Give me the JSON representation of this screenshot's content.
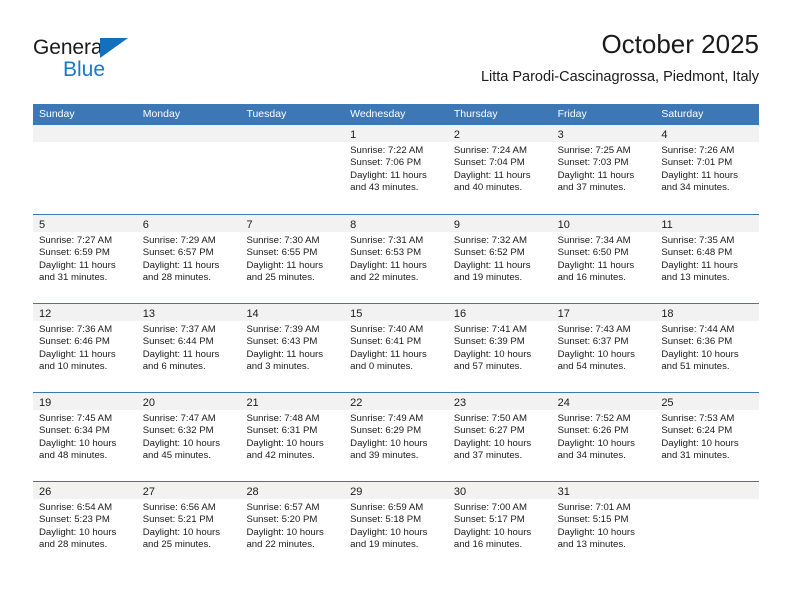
{
  "brand": {
    "name_part1": "General",
    "name_part2": "Blue",
    "color_dark": "#1b1b1b",
    "color_blue": "#1a79c8",
    "triangle_icon": "triangle-icon"
  },
  "header": {
    "title": "October 2025",
    "subtitle": "Litta Parodi-Cascinagrossa, Piedmont, Italy"
  },
  "theme": {
    "header_blue": "#3d77b5",
    "date_band": "#f2f2f2",
    "text": "#1b1b1b"
  },
  "calendar": {
    "day_headers": [
      "Sunday",
      "Monday",
      "Tuesday",
      "Wednesday",
      "Thursday",
      "Friday",
      "Saturday"
    ],
    "weeks": [
      [
        {
          "day": "",
          "lines": []
        },
        {
          "day": "",
          "lines": []
        },
        {
          "day": "",
          "lines": []
        },
        {
          "day": "1",
          "lines": [
            "Sunrise: 7:22 AM",
            "Sunset: 7:06 PM",
            "Daylight: 11 hours",
            "and 43 minutes."
          ]
        },
        {
          "day": "2",
          "lines": [
            "Sunrise: 7:24 AM",
            "Sunset: 7:04 PM",
            "Daylight: 11 hours",
            "and 40 minutes."
          ]
        },
        {
          "day": "3",
          "lines": [
            "Sunrise: 7:25 AM",
            "Sunset: 7:03 PM",
            "Daylight: 11 hours",
            "and 37 minutes."
          ]
        },
        {
          "day": "4",
          "lines": [
            "Sunrise: 7:26 AM",
            "Sunset: 7:01 PM",
            "Daylight: 11 hours",
            "and 34 minutes."
          ]
        }
      ],
      [
        {
          "day": "5",
          "lines": [
            "Sunrise: 7:27 AM",
            "Sunset: 6:59 PM",
            "Daylight: 11 hours",
            "and 31 minutes."
          ]
        },
        {
          "day": "6",
          "lines": [
            "Sunrise: 7:29 AM",
            "Sunset: 6:57 PM",
            "Daylight: 11 hours",
            "and 28 minutes."
          ]
        },
        {
          "day": "7",
          "lines": [
            "Sunrise: 7:30 AM",
            "Sunset: 6:55 PM",
            "Daylight: 11 hours",
            "and 25 minutes."
          ]
        },
        {
          "day": "8",
          "lines": [
            "Sunrise: 7:31 AM",
            "Sunset: 6:53 PM",
            "Daylight: 11 hours",
            "and 22 minutes."
          ]
        },
        {
          "day": "9",
          "lines": [
            "Sunrise: 7:32 AM",
            "Sunset: 6:52 PM",
            "Daylight: 11 hours",
            "and 19 minutes."
          ]
        },
        {
          "day": "10",
          "lines": [
            "Sunrise: 7:34 AM",
            "Sunset: 6:50 PM",
            "Daylight: 11 hours",
            "and 16 minutes."
          ]
        },
        {
          "day": "11",
          "lines": [
            "Sunrise: 7:35 AM",
            "Sunset: 6:48 PM",
            "Daylight: 11 hours",
            "and 13 minutes."
          ]
        }
      ],
      [
        {
          "day": "12",
          "lines": [
            "Sunrise: 7:36 AM",
            "Sunset: 6:46 PM",
            "Daylight: 11 hours",
            "and 10 minutes."
          ]
        },
        {
          "day": "13",
          "lines": [
            "Sunrise: 7:37 AM",
            "Sunset: 6:44 PM",
            "Daylight: 11 hours",
            "and 6 minutes."
          ]
        },
        {
          "day": "14",
          "lines": [
            "Sunrise: 7:39 AM",
            "Sunset: 6:43 PM",
            "Daylight: 11 hours",
            "and 3 minutes."
          ]
        },
        {
          "day": "15",
          "lines": [
            "Sunrise: 7:40 AM",
            "Sunset: 6:41 PM",
            "Daylight: 11 hours",
            "and 0 minutes."
          ]
        },
        {
          "day": "16",
          "lines": [
            "Sunrise: 7:41 AM",
            "Sunset: 6:39 PM",
            "Daylight: 10 hours",
            "and 57 minutes."
          ]
        },
        {
          "day": "17",
          "lines": [
            "Sunrise: 7:43 AM",
            "Sunset: 6:37 PM",
            "Daylight: 10 hours",
            "and 54 minutes."
          ]
        },
        {
          "day": "18",
          "lines": [
            "Sunrise: 7:44 AM",
            "Sunset: 6:36 PM",
            "Daylight: 10 hours",
            "and 51 minutes."
          ]
        }
      ],
      [
        {
          "day": "19",
          "lines": [
            "Sunrise: 7:45 AM",
            "Sunset: 6:34 PM",
            "Daylight: 10 hours",
            "and 48 minutes."
          ]
        },
        {
          "day": "20",
          "lines": [
            "Sunrise: 7:47 AM",
            "Sunset: 6:32 PM",
            "Daylight: 10 hours",
            "and 45 minutes."
          ]
        },
        {
          "day": "21",
          "lines": [
            "Sunrise: 7:48 AM",
            "Sunset: 6:31 PM",
            "Daylight: 10 hours",
            "and 42 minutes."
          ]
        },
        {
          "day": "22",
          "lines": [
            "Sunrise: 7:49 AM",
            "Sunset: 6:29 PM",
            "Daylight: 10 hours",
            "and 39 minutes."
          ]
        },
        {
          "day": "23",
          "lines": [
            "Sunrise: 7:50 AM",
            "Sunset: 6:27 PM",
            "Daylight: 10 hours",
            "and 37 minutes."
          ]
        },
        {
          "day": "24",
          "lines": [
            "Sunrise: 7:52 AM",
            "Sunset: 6:26 PM",
            "Daylight: 10 hours",
            "and 34 minutes."
          ]
        },
        {
          "day": "25",
          "lines": [
            "Sunrise: 7:53 AM",
            "Sunset: 6:24 PM",
            "Daylight: 10 hours",
            "and 31 minutes."
          ]
        }
      ],
      [
        {
          "day": "26",
          "lines": [
            "Sunrise: 6:54 AM",
            "Sunset: 5:23 PM",
            "Daylight: 10 hours",
            "and 28 minutes."
          ]
        },
        {
          "day": "27",
          "lines": [
            "Sunrise: 6:56 AM",
            "Sunset: 5:21 PM",
            "Daylight: 10 hours",
            "and 25 minutes."
          ]
        },
        {
          "day": "28",
          "lines": [
            "Sunrise: 6:57 AM",
            "Sunset: 5:20 PM",
            "Daylight: 10 hours",
            "and 22 minutes."
          ]
        },
        {
          "day": "29",
          "lines": [
            "Sunrise: 6:59 AM",
            "Sunset: 5:18 PM",
            "Daylight: 10 hours",
            "and 19 minutes."
          ]
        },
        {
          "day": "30",
          "lines": [
            "Sunrise: 7:00 AM",
            "Sunset: 5:17 PM",
            "Daylight: 10 hours",
            "and 16 minutes."
          ]
        },
        {
          "day": "31",
          "lines": [
            "Sunrise: 7:01 AM",
            "Sunset: 5:15 PM",
            "Daylight: 10 hours",
            "and 13 minutes."
          ]
        },
        {
          "day": "",
          "lines": []
        }
      ]
    ]
  }
}
